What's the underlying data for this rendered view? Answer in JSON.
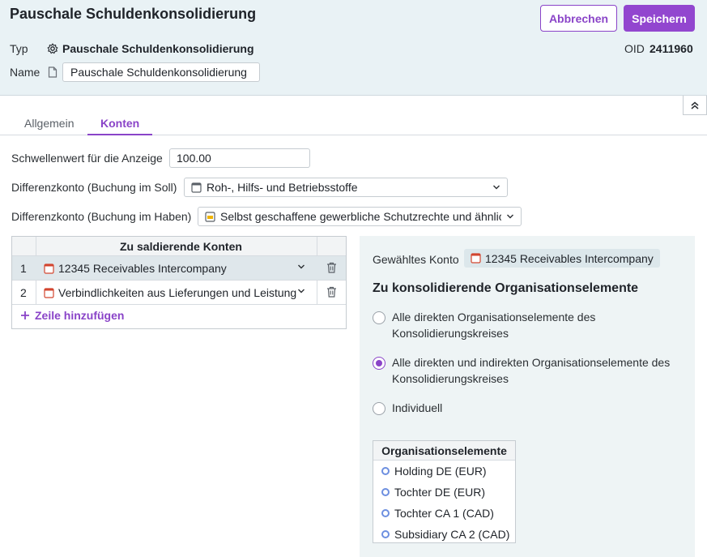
{
  "header": {
    "title": "Pauschale Schuldenkonsolidierung",
    "cancel_label": "Abbrechen",
    "save_label": "Speichern",
    "typ_label": "Typ",
    "typ_value": "Pauschale Schuldenkonsolidierung",
    "oid_label": "OID",
    "oid_value": "2411960",
    "name_label": "Name",
    "name_value": "Pauschale Schuldenkonsolidierung"
  },
  "tabs": [
    {
      "label": "Allgemein",
      "active": false
    },
    {
      "label": "Konten",
      "active": true
    }
  ],
  "form": {
    "threshold_label": "Schwellenwert für die Anzeige",
    "threshold_value": "100.00",
    "soll_label": "Differenzkonto (Buchung im Soll)",
    "soll_value": "Roh-, Hilfs- und Betriebsstoffe",
    "haben_label": "Differenzkonto (Buchung im Haben)",
    "haben_value": "Selbst geschaffene gewerbliche Schutzrechte und ähnlic"
  },
  "grid": {
    "header": "Zu saldierende Konten",
    "rows": [
      {
        "num": "1",
        "account": "12345 Receivables Intercompany",
        "selected": true
      },
      {
        "num": "2",
        "account": "Verbindlichkeiten aus Lieferungen und Leistung",
        "selected": false
      }
    ],
    "add_label": "Zeile hinzufügen"
  },
  "panel": {
    "selected_label": "Gewähltes Konto",
    "selected_value": "12345 Receivables Intercompany",
    "heading": "Zu konsolidierende Organisationselemente",
    "options": [
      {
        "line1": "Alle direkten Organisationselemente des",
        "line2": "Konsolidierungskreises",
        "checked": false
      },
      {
        "line1": "Alle direkten und indirekten Organisationselemente des",
        "line2": "Konsolidierungskreises",
        "checked": true
      },
      {
        "line1": "Individuell",
        "line2": "",
        "checked": false
      }
    ],
    "org_header": "Organisationselemente",
    "org_items": [
      "Holding DE (EUR)",
      "Tochter DE (EUR)",
      "Tochter CA 1 (CAD)",
      "Subsidiary CA 2 (CAD)"
    ]
  },
  "colors": {
    "accent": "#8a44c8",
    "header_bg": "#e9f2f5",
    "panel_bg": "#eef4f5"
  },
  "icons": {
    "typ": "gear-flower-icon",
    "name": "document-icon",
    "account_red": "ledger-red-icon",
    "account_grey": "ledger-grey-icon",
    "account_yellow": "ledger-yellow-icon",
    "collapse": "double-chevron-up-icon",
    "delete": "trash-icon",
    "add": "plus-icon"
  }
}
